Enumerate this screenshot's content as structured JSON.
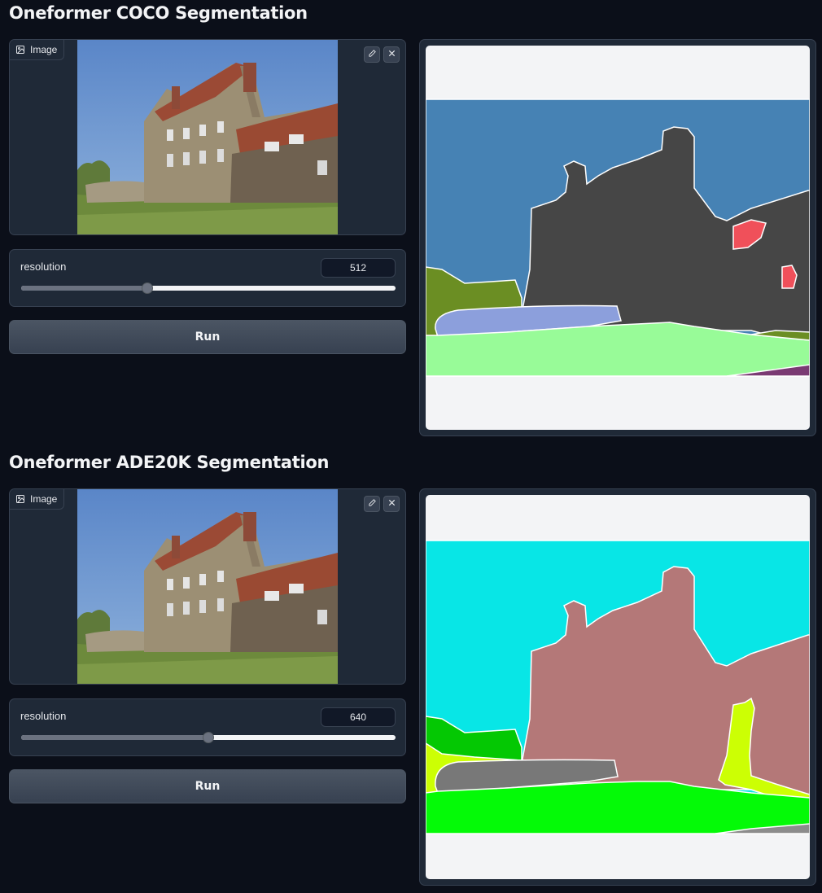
{
  "sections": [
    {
      "title": "Oneformer COCO Segmentation",
      "image_label": "Image",
      "resolution_label": "resolution",
      "resolution_value": "512",
      "resolution_fraction": 0.337,
      "run_label": "Run",
      "colors": {
        "sky": "#4682b4",
        "building": "#464646",
        "tree": "#6b8e23",
        "wall": "#8c9fdc",
        "grass": "#98fb98",
        "window": "#f0505a",
        "road": "#7a3a73"
      }
    },
    {
      "title": "Oneformer ADE20K Segmentation",
      "image_label": "Image",
      "resolution_label": "resolution",
      "resolution_value": "640",
      "resolution_fraction": 0.5,
      "run_label": "Run",
      "colors": {
        "sky": "#08e6e6",
        "building": "#b47878",
        "tree": "#04c803",
        "wall": "#787878",
        "grass": "#04fa07",
        "plant": "#ccff04",
        "road": "#8c8c8c"
      }
    }
  ],
  "icons": {
    "image": "image-icon",
    "edit": "pencil-icon",
    "clear": "close-icon"
  }
}
